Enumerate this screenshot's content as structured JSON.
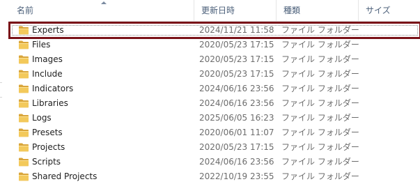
{
  "columns": {
    "name": "名前",
    "date": "更新日時",
    "type": "種類",
    "size": "サイズ"
  },
  "rows": [
    {
      "name": "Experts",
      "date": "2024/11/21 11:58",
      "type": "ファイル フォルダー"
    },
    {
      "name": "Files",
      "date": "2020/05/23 17:15",
      "type": "ファイル フォルダー"
    },
    {
      "name": "Images",
      "date": "2020/05/23 17:15",
      "type": "ファイル フォルダー"
    },
    {
      "name": "Include",
      "date": "2020/05/23 17:15",
      "type": "ファイル フォルダー"
    },
    {
      "name": "Indicators",
      "date": "2024/06/16 23:56",
      "type": "ファイル フォルダー"
    },
    {
      "name": "Libraries",
      "date": "2024/06/16 23:56",
      "type": "ファイル フォルダー"
    },
    {
      "name": "Logs",
      "date": "2025/06/05 16:23",
      "type": "ファイル フォルダー"
    },
    {
      "name": "Presets",
      "date": "2020/06/01 11:07",
      "type": "ファイル フォルダー"
    },
    {
      "name": "Projects",
      "date": "2020/05/23 17:15",
      "type": "ファイル フォルダー"
    },
    {
      "name": "Scripts",
      "date": "2024/06/16 23:56",
      "type": "ファイル フォルダー"
    },
    {
      "name": "Shared Projects",
      "date": "2022/10/19 23:55",
      "type": "ファイル フォルダー"
    }
  ],
  "icon": "folder-icon",
  "colors": {
    "selection_outline": "#7a1218",
    "folder": "#e8b84a",
    "header_text": "#4c607a",
    "secondary_text": "#6d6d6d"
  }
}
